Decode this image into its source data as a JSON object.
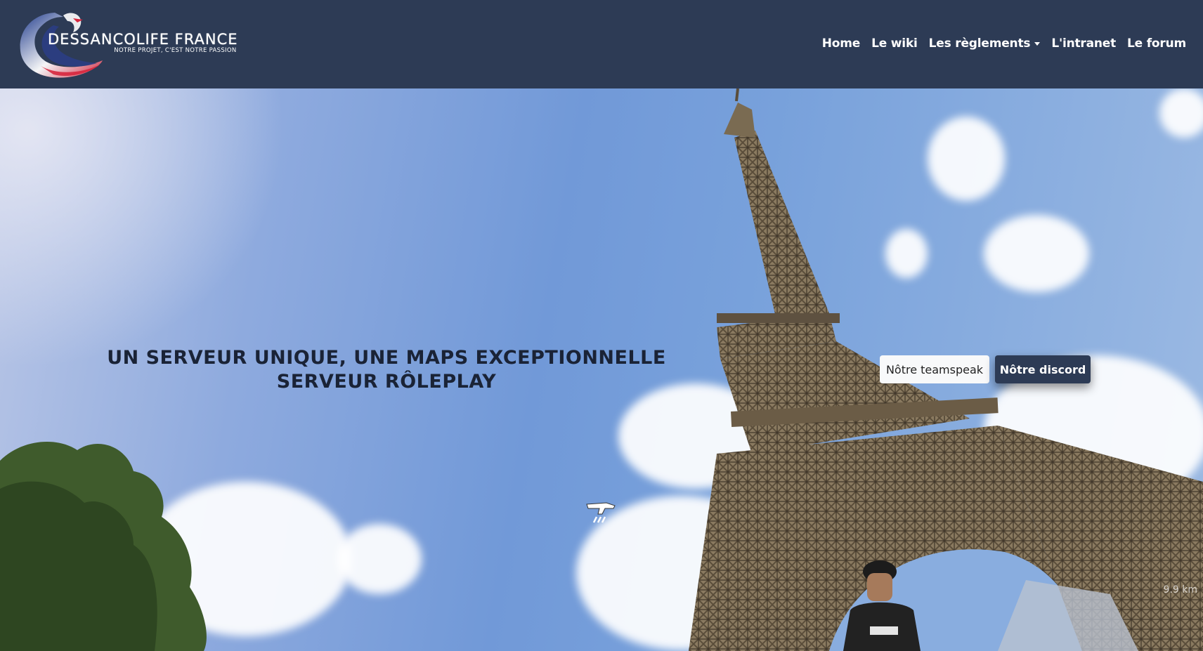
{
  "brand": {
    "title": "DESSANCOLIFE  FRANCE",
    "tagline": "NOTRE PROJET, C'EST NOTRE PASSION"
  },
  "nav": {
    "items": [
      {
        "label": "Home"
      },
      {
        "label": "Le wiki"
      },
      {
        "label": "Les règlements"
      },
      {
        "label": "L'intranet"
      },
      {
        "label": "Le forum"
      }
    ]
  },
  "hero": {
    "heading_line1": "UN SERVEUR UNIQUE, UNE MAPS EXCEPTIONNELLE",
    "heading_line2": "SERVEUR RÔLEPLAY",
    "teamspeak_button": "Nôtre teamspeak",
    "discord_button": "Nôtre discord",
    "distance_readout": "9.9 km"
  },
  "colors": {
    "navbar_bg": "#2d3b55",
    "sky": "#7199d8",
    "heading": "#1a2336",
    "discord_button_bg": "#2d3b55"
  }
}
